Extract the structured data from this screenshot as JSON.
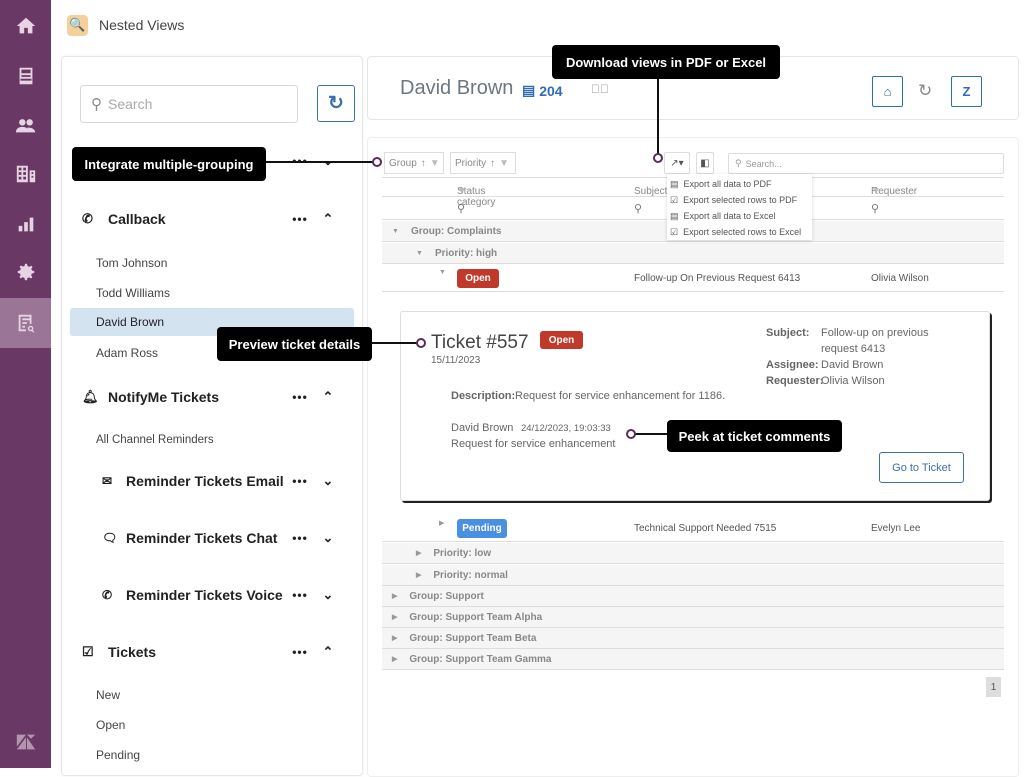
{
  "app": {
    "title": "Nested Views",
    "logo_icon": "nested-views-logo"
  },
  "rail": {
    "items": [
      {
        "name": "home",
        "icon": "home-icon"
      },
      {
        "name": "views",
        "icon": "inbox-icon"
      },
      {
        "name": "customers",
        "icon": "users-icon"
      },
      {
        "name": "organizations",
        "icon": "building-icon"
      },
      {
        "name": "reporting",
        "icon": "bar-chart-icon"
      },
      {
        "name": "admin",
        "icon": "gear-icon"
      },
      {
        "name": "nested-views",
        "icon": "list-search-icon",
        "active": true
      }
    ],
    "footer_icon": "zendesk-icon"
  },
  "left": {
    "search_placeholder": "Search",
    "sections": [
      {
        "label": "Callback",
        "icon": "phone-icon",
        "expanded": true,
        "items": [
          "Tom Johnson",
          "Todd Williams",
          "David Brown",
          "Adam Ross"
        ],
        "selected": "David Brown"
      },
      {
        "label": "NotifyMe Tickets",
        "icon": "bell-icon",
        "expanded": true,
        "items": [
          "All Channel Reminders"
        ],
        "subsections": [
          {
            "label": "Reminder Tickets Email",
            "icon": "envelope-icon"
          },
          {
            "label": "Reminder Tickets Chat",
            "icon": "chat-icon"
          },
          {
            "label": "Reminder Tickets Voice",
            "icon": "phone-icon"
          }
        ]
      },
      {
        "label": "Tickets",
        "icon": "checkbox-icon",
        "expanded": true,
        "items": [
          "New",
          "Open",
          "Pending"
        ]
      }
    ]
  },
  "header": {
    "name": "David Brown",
    "count": "204"
  },
  "grid": {
    "group_chips": [
      "Group",
      "Priority"
    ],
    "search_placeholder": "Search...",
    "columns": [
      "Status category",
      "Subject",
      "Requester"
    ],
    "export_menu": [
      "Export all data to PDF",
      "Export selected rows to PDF",
      "Export all data to Excel",
      "Export selected rows to Excel"
    ],
    "rows": {
      "g1": "Group: Complaints",
      "p1": "Priority: high",
      "r1": {
        "status": "Open",
        "subject": "Follow-up On Previous Request 6413",
        "requester": "Olivia Wilson"
      },
      "r2": {
        "status": "Pending",
        "subject": "Technical Support Needed 7515",
        "requester": "Evelyn Lee"
      },
      "p2": "Priority: low",
      "p3": "Priority: normal",
      "g2": "Group: Support",
      "g3": "Group: Support Team Alpha",
      "g4": "Group: Support Team Beta",
      "g5": "Group: Support Team Gamma"
    },
    "page": "1"
  },
  "detail": {
    "title": "Ticket #557",
    "status": "Open",
    "date": "15/11/2023",
    "subject_label": "Subject:",
    "subject": "Follow-up on previous",
    "subject2": "request 6413",
    "assignee_label": "Assignee:",
    "assignee": "David Brown",
    "requester_label": "Requester:",
    "requester": "Olivia Wilson",
    "description_label": "Description:",
    "description": "Request for service enhancement for 1186.",
    "comment_author": "David Brown",
    "comment_time": "24/12/2023, 19:03:33",
    "comment_text": "Request for service enhancement",
    "go_button": "Go to Ticket"
  },
  "callouts": {
    "download": "Download views in PDF or Excel",
    "grouping": "Integrate multiple-grouping",
    "preview": "Preview ticket details",
    "comments": "Peek at ticket comments"
  },
  "colors": {
    "rail": "#6a3865",
    "accent": "#2f6db4",
    "open": "#c0392b",
    "pending": "#4a90e2"
  }
}
